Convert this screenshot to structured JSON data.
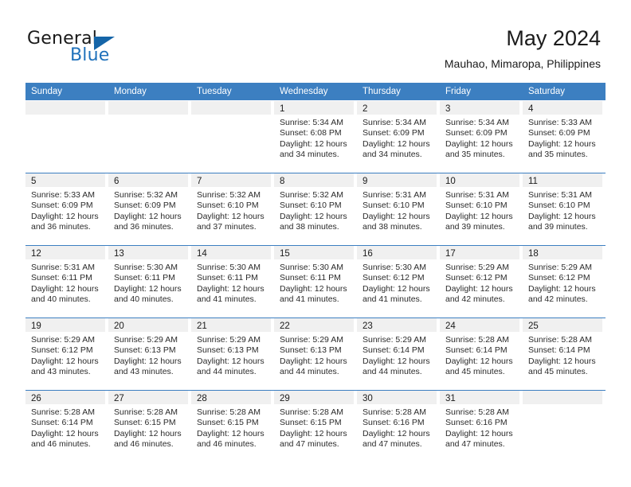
{
  "logo": {
    "word_top": "General",
    "word_bottom": "Blue",
    "accent_color": "#1565a8"
  },
  "header": {
    "title": "May 2024",
    "subtitle": "Mauhao, Mimaropa, Philippines"
  },
  "theme": {
    "header_blue": "#3c7fc1",
    "day_strip_gray": "#f0f0f0",
    "text": "#1b1b1b"
  },
  "weekdays": [
    "Sunday",
    "Monday",
    "Tuesday",
    "Wednesday",
    "Thursday",
    "Friday",
    "Saturday"
  ],
  "labels": {
    "sunrise_prefix": "Sunrise: ",
    "sunset_prefix": "Sunset: ",
    "daylight_prefix": "Daylight: "
  },
  "weeks": [
    [
      {
        "day": "",
        "empty": true
      },
      {
        "day": "",
        "empty": true
      },
      {
        "day": "",
        "empty": true
      },
      {
        "day": "1",
        "sunrise": "Sunrise: 5:34 AM",
        "sunset": "Sunset: 6:08 PM",
        "daylight": "Daylight: 12 hours and 34 minutes."
      },
      {
        "day": "2",
        "sunrise": "Sunrise: 5:34 AM",
        "sunset": "Sunset: 6:09 PM",
        "daylight": "Daylight: 12 hours and 34 minutes."
      },
      {
        "day": "3",
        "sunrise": "Sunrise: 5:34 AM",
        "sunset": "Sunset: 6:09 PM",
        "daylight": "Daylight: 12 hours and 35 minutes."
      },
      {
        "day": "4",
        "sunrise": "Sunrise: 5:33 AM",
        "sunset": "Sunset: 6:09 PM",
        "daylight": "Daylight: 12 hours and 35 minutes."
      }
    ],
    [
      {
        "day": "5",
        "sunrise": "Sunrise: 5:33 AM",
        "sunset": "Sunset: 6:09 PM",
        "daylight": "Daylight: 12 hours and 36 minutes."
      },
      {
        "day": "6",
        "sunrise": "Sunrise: 5:32 AM",
        "sunset": "Sunset: 6:09 PM",
        "daylight": "Daylight: 12 hours and 36 minutes."
      },
      {
        "day": "7",
        "sunrise": "Sunrise: 5:32 AM",
        "sunset": "Sunset: 6:10 PM",
        "daylight": "Daylight: 12 hours and 37 minutes."
      },
      {
        "day": "8",
        "sunrise": "Sunrise: 5:32 AM",
        "sunset": "Sunset: 6:10 PM",
        "daylight": "Daylight: 12 hours and 38 minutes."
      },
      {
        "day": "9",
        "sunrise": "Sunrise: 5:31 AM",
        "sunset": "Sunset: 6:10 PM",
        "daylight": "Daylight: 12 hours and 38 minutes."
      },
      {
        "day": "10",
        "sunrise": "Sunrise: 5:31 AM",
        "sunset": "Sunset: 6:10 PM",
        "daylight": "Daylight: 12 hours and 39 minutes."
      },
      {
        "day": "11",
        "sunrise": "Sunrise: 5:31 AM",
        "sunset": "Sunset: 6:10 PM",
        "daylight": "Daylight: 12 hours and 39 minutes."
      }
    ],
    [
      {
        "day": "12",
        "sunrise": "Sunrise: 5:31 AM",
        "sunset": "Sunset: 6:11 PM",
        "daylight": "Daylight: 12 hours and 40 minutes."
      },
      {
        "day": "13",
        "sunrise": "Sunrise: 5:30 AM",
        "sunset": "Sunset: 6:11 PM",
        "daylight": "Daylight: 12 hours and 40 minutes."
      },
      {
        "day": "14",
        "sunrise": "Sunrise: 5:30 AM",
        "sunset": "Sunset: 6:11 PM",
        "daylight": "Daylight: 12 hours and 41 minutes."
      },
      {
        "day": "15",
        "sunrise": "Sunrise: 5:30 AM",
        "sunset": "Sunset: 6:11 PM",
        "daylight": "Daylight: 12 hours and 41 minutes."
      },
      {
        "day": "16",
        "sunrise": "Sunrise: 5:30 AM",
        "sunset": "Sunset: 6:12 PM",
        "daylight": "Daylight: 12 hours and 41 minutes."
      },
      {
        "day": "17",
        "sunrise": "Sunrise: 5:29 AM",
        "sunset": "Sunset: 6:12 PM",
        "daylight": "Daylight: 12 hours and 42 minutes."
      },
      {
        "day": "18",
        "sunrise": "Sunrise: 5:29 AM",
        "sunset": "Sunset: 6:12 PM",
        "daylight": "Daylight: 12 hours and 42 minutes."
      }
    ],
    [
      {
        "day": "19",
        "sunrise": "Sunrise: 5:29 AM",
        "sunset": "Sunset: 6:12 PM",
        "daylight": "Daylight: 12 hours and 43 minutes."
      },
      {
        "day": "20",
        "sunrise": "Sunrise: 5:29 AM",
        "sunset": "Sunset: 6:13 PM",
        "daylight": "Daylight: 12 hours and 43 minutes."
      },
      {
        "day": "21",
        "sunrise": "Sunrise: 5:29 AM",
        "sunset": "Sunset: 6:13 PM",
        "daylight": "Daylight: 12 hours and 44 minutes."
      },
      {
        "day": "22",
        "sunrise": "Sunrise: 5:29 AM",
        "sunset": "Sunset: 6:13 PM",
        "daylight": "Daylight: 12 hours and 44 minutes."
      },
      {
        "day": "23",
        "sunrise": "Sunrise: 5:29 AM",
        "sunset": "Sunset: 6:14 PM",
        "daylight": "Daylight: 12 hours and 44 minutes."
      },
      {
        "day": "24",
        "sunrise": "Sunrise: 5:28 AM",
        "sunset": "Sunset: 6:14 PM",
        "daylight": "Daylight: 12 hours and 45 minutes."
      },
      {
        "day": "25",
        "sunrise": "Sunrise: 5:28 AM",
        "sunset": "Sunset: 6:14 PM",
        "daylight": "Daylight: 12 hours and 45 minutes."
      }
    ],
    [
      {
        "day": "26",
        "sunrise": "Sunrise: 5:28 AM",
        "sunset": "Sunset: 6:14 PM",
        "daylight": "Daylight: 12 hours and 46 minutes."
      },
      {
        "day": "27",
        "sunrise": "Sunrise: 5:28 AM",
        "sunset": "Sunset: 6:15 PM",
        "daylight": "Daylight: 12 hours and 46 minutes."
      },
      {
        "day": "28",
        "sunrise": "Sunrise: 5:28 AM",
        "sunset": "Sunset: 6:15 PM",
        "daylight": "Daylight: 12 hours and 46 minutes."
      },
      {
        "day": "29",
        "sunrise": "Sunrise: 5:28 AM",
        "sunset": "Sunset: 6:15 PM",
        "daylight": "Daylight: 12 hours and 47 minutes."
      },
      {
        "day": "30",
        "sunrise": "Sunrise: 5:28 AM",
        "sunset": "Sunset: 6:16 PM",
        "daylight": "Daylight: 12 hours and 47 minutes."
      },
      {
        "day": "31",
        "sunrise": "Sunrise: 5:28 AM",
        "sunset": "Sunset: 6:16 PM",
        "daylight": "Daylight: 12 hours and 47 minutes."
      },
      {
        "day": "",
        "empty": true
      }
    ]
  ]
}
